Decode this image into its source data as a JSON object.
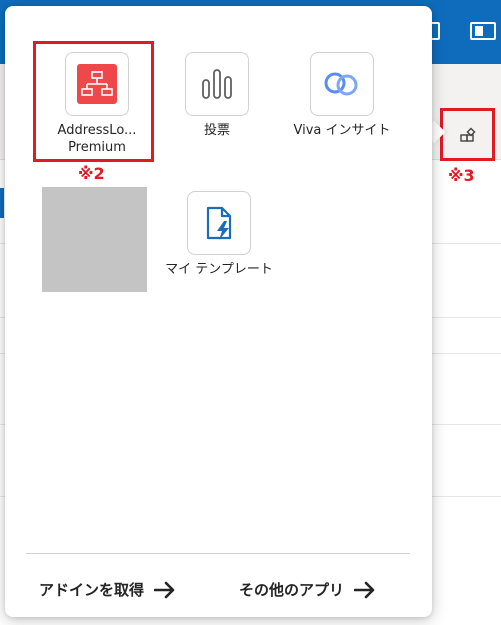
{
  "flyout": {
    "apps": [
      {
        "label": "AddressLo... Premium",
        "icon": "org-chart-icon",
        "color": "#f0484a"
      },
      {
        "label": "投票",
        "icon": "poll-bars-icon",
        "color": "#616161"
      },
      {
        "label": "Viva インサイト",
        "icon": "viva-insights-icon",
        "color": "#5b8cf5"
      },
      {
        "label": "",
        "icon": "placeholder"
      },
      {
        "label": "マイ テンプレート",
        "icon": "template-document-icon",
        "color": "#1e6bb8"
      }
    ],
    "footer": {
      "get_addins": "アドインを取得",
      "more_apps": "その他のアプリ"
    }
  },
  "callouts": {
    "note2": "※2",
    "note3": "※3"
  },
  "colors": {
    "accent": "#0f6cbd",
    "callout": "#e21b23"
  }
}
